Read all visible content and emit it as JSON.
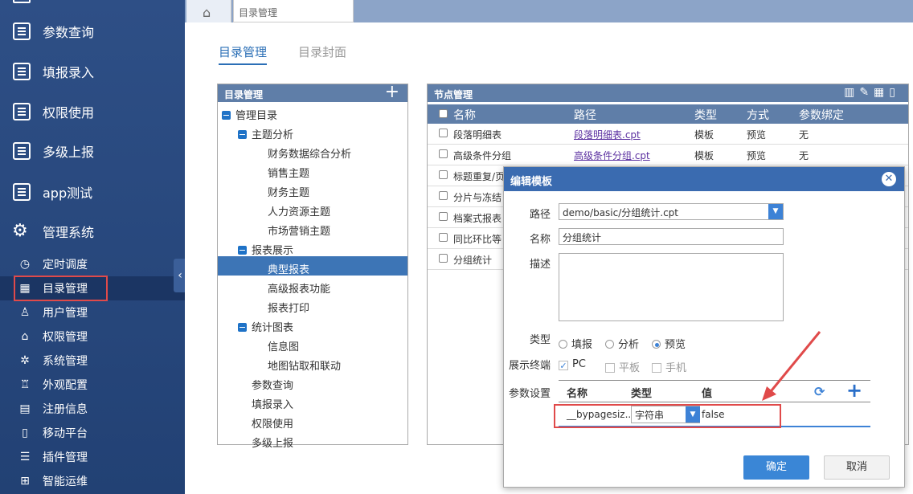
{
  "sidebar": {
    "main_items": [
      "参数查询",
      "填报录入",
      "权限使用",
      "多级上报",
      "app测试",
      "管理系统"
    ],
    "sub_items": [
      "定时调度",
      "目录管理",
      "用户管理",
      "权限管理",
      "系统管理",
      "外观配置",
      "注册信息",
      "移动平台",
      "插件管理",
      "智能运维"
    ],
    "active": "目录管理"
  },
  "tabs": {
    "current": "目录管理"
  },
  "subtabs": [
    "目录管理",
    "目录封面"
  ],
  "tree_panel": {
    "title": "目录管理",
    "nodes": [
      "管理目录",
      "主题分析",
      "财务数据综合分析",
      "销售主题",
      "财务主题",
      "人力资源主题",
      "市场营销主题",
      "报表展示",
      "典型报表",
      "高级报表功能",
      "报表打印",
      "统计图表",
      "信息图",
      "地图钻取和联动",
      "参数查询",
      "填报录入",
      "权限使用",
      "多级上报"
    ]
  },
  "node_panel": {
    "title": "节点管理",
    "columns": [
      "名称",
      "路径",
      "类型",
      "方式",
      "参数绑定"
    ],
    "rows": [
      {
        "name": "段落明细表",
        "path": "段落明细表.cpt",
        "type": "模板",
        "mode": "预览",
        "bind": "无"
      },
      {
        "name": "高级条件分组",
        "path": "高级条件分组.cpt",
        "type": "模板",
        "mode": "预览",
        "bind": "无"
      },
      {
        "name": "标题重复/页"
      },
      {
        "name": "分片与冻结"
      },
      {
        "name": "档案式报表"
      },
      {
        "name": "同比环比等"
      },
      {
        "name": "分组统计"
      }
    ]
  },
  "dialog": {
    "title": "编辑模板",
    "path_label": "路径",
    "path_value": "demo/basic/分组统计.cpt",
    "name_label": "名称",
    "name_value": "分组统计",
    "desc_label": "描述",
    "type_label": "类型",
    "type_options": [
      "填报",
      "分析",
      "预览"
    ],
    "type_selected": "预览",
    "terminal_label": "展示终端",
    "terminal_options": [
      "PC",
      "平板",
      "手机"
    ],
    "terminal_checked": "PC",
    "param_label": "参数设置",
    "param_cols": [
      "名称",
      "类型",
      "值"
    ],
    "param_row": {
      "name": "__bypagesiz...",
      "type": "字符串",
      "value": "false"
    },
    "ok": "确定",
    "cancel": "取消"
  }
}
